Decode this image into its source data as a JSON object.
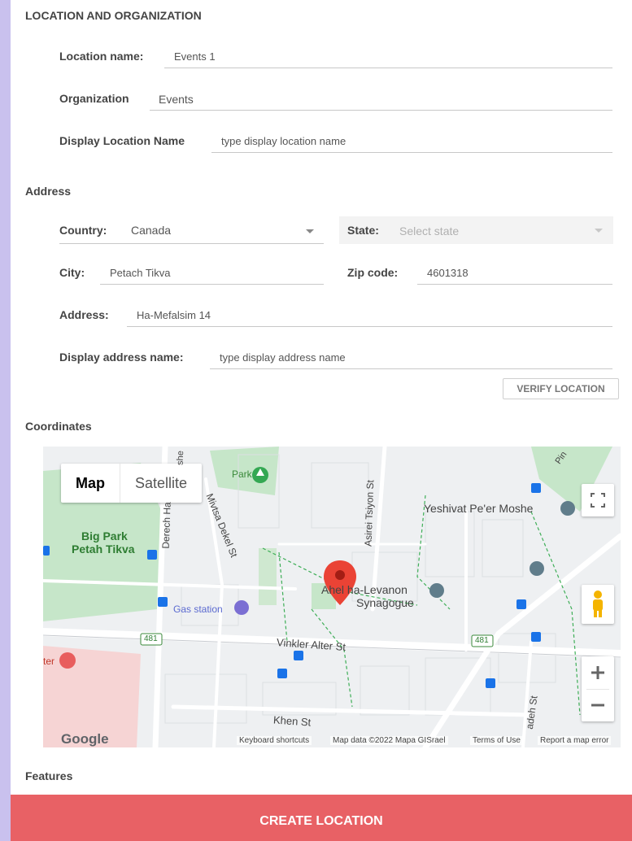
{
  "sections": {
    "location": "LOCATION AND ORGANIZATION",
    "address": "Address",
    "coordinates": "Coordinates",
    "features": "Features"
  },
  "location": {
    "name_label": "Location name:",
    "name_value": "Events 1",
    "org_label": "Organization",
    "org_value": "Events",
    "display_label": "Display Location Name",
    "display_placeholder": "type display location name"
  },
  "address": {
    "country_label": "Country:",
    "country_value": "Canada",
    "state_label": "State:",
    "state_placeholder": "Select state",
    "city_label": "City:",
    "city_value": "Petach Tikva",
    "zip_label": "Zip code:",
    "zip_value": "4601318",
    "address_label": "Address:",
    "address_value": "Ha-Mefalsim 14",
    "display_label": "Display address name:",
    "display_placeholder": "type display address name",
    "verify_label": "VERIFY LOCATION"
  },
  "map": {
    "type_map": "Map",
    "type_satellite": "Satellite",
    "labels": {
      "park": "Park",
      "big_park": "Big Park",
      "big_park2": "Petah Tikva",
      "yeshivat": "Yeshivat Pe'er Moshe",
      "synagogue1": "Ahel ha-Levanon",
      "synagogue2": "Synagogue",
      "gas": "Gas station",
      "vinkler": "Vinkler Alter St",
      "khen": "Khen St",
      "asirei": "Asirei Tsiyon St",
      "mivtsa": "Mivtsa Dekel St",
      "derech": "Derech Ha",
      "route": "481",
      "route2": "481",
      "shed": "adeh St",
      "pin": "Pin",
      "she": "she",
      "ter": "ter"
    },
    "footer": {
      "keyboard": "Keyboard shortcuts",
      "data": "Map data ©2022 Mapa GISrael",
      "terms": "Terms of Use",
      "report": "Report a map error"
    },
    "logo": "Google",
    "colors": {
      "pin": "#ea4335",
      "park": "#c6e6c9",
      "road": "#ffffff",
      "transit": "#1a73e8"
    }
  },
  "create_label": "CREATE LOCATION"
}
